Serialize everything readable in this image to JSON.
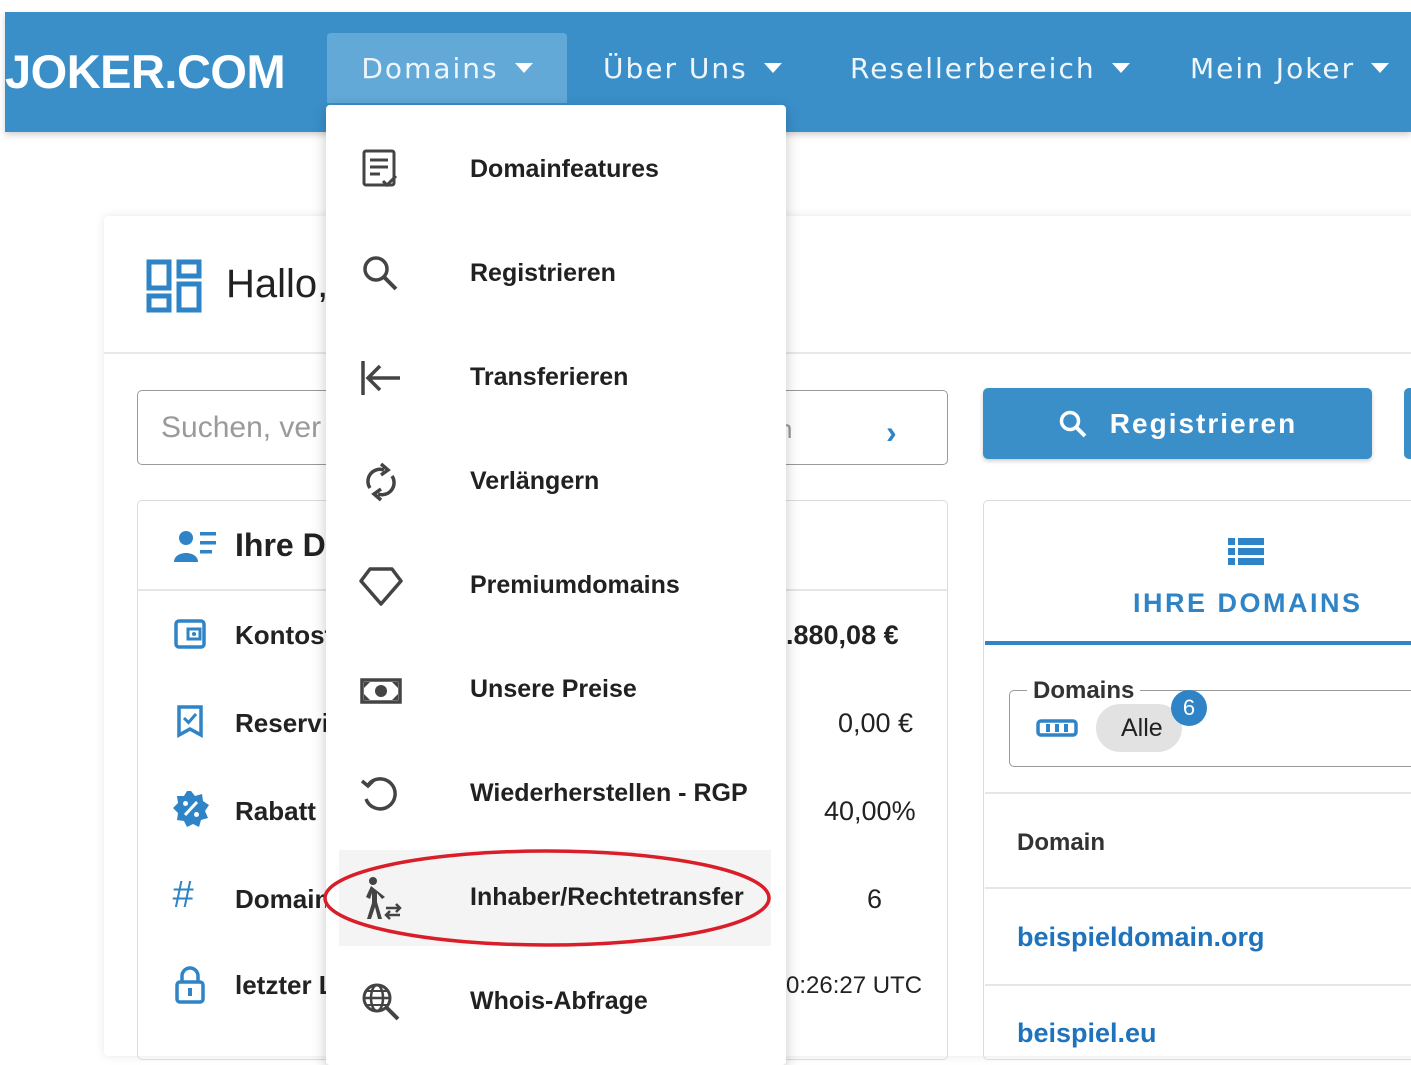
{
  "brand": {
    "logo": "JOKER.COM"
  },
  "nav": {
    "items": [
      {
        "label": "Domains"
      },
      {
        "label": "Über Uns"
      },
      {
        "label": "Resellerbereich"
      },
      {
        "label": "Mein Joker"
      }
    ]
  },
  "dropdown": {
    "items": [
      {
        "label": "Domainfeatures",
        "icon": "document-check-icon"
      },
      {
        "label": "Registrieren",
        "icon": "search-icon"
      },
      {
        "label": "Transferieren",
        "icon": "arrow-to-left-icon"
      },
      {
        "label": "Verlängern",
        "icon": "refresh-icon"
      },
      {
        "label": "Premiumdomains",
        "icon": "diamond-icon"
      },
      {
        "label": "Unsere Preise",
        "icon": "money-icon"
      },
      {
        "label": "Wiederherstellen - RGP",
        "icon": "restore-icon"
      },
      {
        "label": "Inhaber/Rechtetransfer",
        "icon": "person-transfer-icon"
      },
      {
        "label": "Whois-Abfrage",
        "icon": "globe-search-icon"
      }
    ],
    "highlighted": "Inhaber/Rechtetransfer",
    "highlight_color": "#d91e2a"
  },
  "greeting": {
    "text": "Hallo,"
  },
  "search": {
    "placeholder_visible": "Suchen, ver",
    "fragment": "n"
  },
  "register_button": {
    "label": "Registrieren"
  },
  "info_panel": {
    "title": "Ihre D",
    "rows": [
      {
        "label": "Kontost",
        "value": ".880,08 €",
        "icon": "wallet-icon"
      },
      {
        "label": "Reservi",
        "value": "0,00 €",
        "icon": "bookmark-check-icon"
      },
      {
        "label": "Rabatt",
        "value": "40,00%",
        "icon": "discount-badge-icon"
      },
      {
        "label": "Domain",
        "value": "6",
        "icon": "hash-icon"
      },
      {
        "label": "letzter L",
        "value": "0:26:27 UTC",
        "icon": "lock-icon"
      }
    ]
  },
  "domains_panel": {
    "tab_label": "IHRE DOMAINS",
    "filter_legend": "Domains",
    "chip_label": "Alle",
    "badge_count": "6",
    "column_header": "Domain",
    "domains": [
      "beispieldomain.org",
      "beispiel.eu"
    ]
  },
  "colors": {
    "brand_blue": "#3a8fc9",
    "link_blue": "#1f73bc",
    "accent": "#2e84c6"
  }
}
